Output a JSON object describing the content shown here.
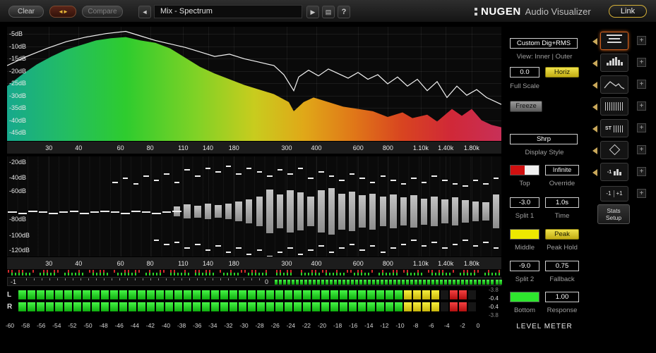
{
  "icons": {
    "swap": "◄►",
    "prev": "◄",
    "play": "▶",
    "list": "▤",
    "add": "+"
  },
  "toolbar": {
    "clear": "Clear",
    "compare": "Compare",
    "preset": "Mix - Spectrum",
    "help": "?",
    "brand_main": "NUGEN",
    "brand_sub": "Audio Visualizer",
    "link": "Link"
  },
  "spectrum": {
    "db_labels": [
      "-5dB",
      "-10dB",
      "-15dB",
      "-20dB",
      "-25dB",
      "-30dB",
      "-35dB",
      "-40dB",
      "-45dB"
    ],
    "freqs": [
      {
        "v": 30,
        "l": "30"
      },
      {
        "v": 40,
        "l": "40"
      },
      {
        "v": 60,
        "l": "60"
      },
      {
        "v": 80,
        "l": "80"
      },
      {
        "v": 110,
        "l": "110"
      },
      {
        "v": 140,
        "l": "140"
      },
      {
        "v": 180,
        "l": "180"
      },
      {
        "v": 300,
        "l": "300"
      },
      {
        "v": 400,
        "l": "400"
      },
      {
        "v": 600,
        "l": "600"
      },
      {
        "v": 800,
        "l": "800"
      },
      {
        "v": 1100,
        "l": "1.10k"
      },
      {
        "v": 1400,
        "l": "1.40k"
      },
      {
        "v": 1800,
        "l": "1.80k"
      }
    ],
    "freq_range": [
      20,
      2400
    ],
    "gradient_stops": [
      [
        "0%",
        "#17a98d"
      ],
      [
        "12%",
        "#23bd62"
      ],
      [
        "24%",
        "#2ecc2e"
      ],
      [
        "38%",
        "#7ed226"
      ],
      [
        "50%",
        "#c8cc1e"
      ],
      [
        "60%",
        "#e0a818"
      ],
      [
        "70%",
        "#e07818"
      ],
      [
        "80%",
        "#d84420"
      ],
      [
        "90%",
        "#d02838"
      ],
      [
        "100%",
        "#c83058"
      ]
    ],
    "fill_curve": [
      [
        0,
        0.52
      ],
      [
        0.03,
        0.42
      ],
      [
        0.06,
        0.33
      ],
      [
        0.09,
        0.26
      ],
      [
        0.12,
        0.2
      ],
      [
        0.15,
        0.16
      ],
      [
        0.18,
        0.12
      ],
      [
        0.21,
        0.1
      ],
      [
        0.24,
        0.09
      ],
      [
        0.27,
        0.12
      ],
      [
        0.3,
        0.14
      ],
      [
        0.33,
        0.19
      ],
      [
        0.36,
        0.27
      ],
      [
        0.39,
        0.35
      ],
      [
        0.42,
        0.41
      ],
      [
        0.45,
        0.46
      ],
      [
        0.48,
        0.51
      ],
      [
        0.51,
        0.55
      ],
      [
        0.54,
        0.59
      ],
      [
        0.57,
        0.66
      ],
      [
        0.58,
        0.74
      ],
      [
        0.6,
        0.66
      ],
      [
        0.62,
        0.62
      ],
      [
        0.65,
        0.66
      ],
      [
        0.68,
        0.7
      ],
      [
        0.71,
        0.72
      ],
      [
        0.74,
        0.74
      ],
      [
        0.77,
        0.79
      ],
      [
        0.8,
        0.75
      ],
      [
        0.82,
        0.8
      ],
      [
        0.85,
        0.77
      ],
      [
        0.87,
        0.83
      ],
      [
        0.9,
        0.72
      ],
      [
        0.92,
        0.78
      ],
      [
        0.94,
        0.72
      ],
      [
        0.96,
        0.82
      ],
      [
        0.98,
        0.86
      ],
      [
        1,
        0.88
      ]
    ],
    "line_curve": [
      [
        0,
        0.34
      ],
      [
        0.04,
        0.26
      ],
      [
        0.08,
        0.19
      ],
      [
        0.12,
        0.13
      ],
      [
        0.16,
        0.09
      ],
      [
        0.2,
        0.06
      ],
      [
        0.24,
        0.04
      ],
      [
        0.27,
        0.08
      ],
      [
        0.3,
        0.12
      ],
      [
        0.33,
        0.15
      ],
      [
        0.36,
        0.18
      ],
      [
        0.39,
        0.22
      ],
      [
        0.42,
        0.26
      ],
      [
        0.45,
        0.24
      ],
      [
        0.48,
        0.28
      ],
      [
        0.51,
        0.31
      ],
      [
        0.54,
        0.34
      ],
      [
        0.56,
        0.42
      ],
      [
        0.58,
        0.56
      ],
      [
        0.59,
        0.44
      ],
      [
        0.61,
        0.38
      ],
      [
        0.63,
        0.43
      ],
      [
        0.65,
        0.37
      ],
      [
        0.67,
        0.41
      ],
      [
        0.69,
        0.45
      ],
      [
        0.71,
        0.4
      ],
      [
        0.73,
        0.46
      ],
      [
        0.75,
        0.42
      ],
      [
        0.77,
        0.5
      ],
      [
        0.79,
        0.44
      ],
      [
        0.81,
        0.52
      ],
      [
        0.83,
        0.46
      ],
      [
        0.85,
        0.56
      ],
      [
        0.87,
        0.48
      ],
      [
        0.89,
        0.62
      ],
      [
        0.91,
        0.52
      ],
      [
        0.93,
        0.6
      ],
      [
        0.95,
        0.55
      ],
      [
        0.97,
        0.62
      ],
      [
        1,
        0.68
      ]
    ]
  },
  "histogram": {
    "db_labels": [
      {
        "l": "-20dB",
        "p": 0.03
      },
      {
        "l": "-40dB",
        "p": 0.18
      },
      {
        "l": "-60dB",
        "p": 0.32
      },
      {
        "l": "-80dB",
        "p": 0.6
      },
      {
        "l": "-100dB",
        "p": 0.76
      },
      {
        "l": "-120dB",
        "p": 0.91
      }
    ],
    "center": 0.55,
    "slots": 48,
    "bars": [
      null,
      null,
      null,
      null,
      null,
      null,
      null,
      null,
      null,
      null,
      null,
      null,
      null,
      null,
      null,
      null,
      0.1,
      0.14,
      0.12,
      0.16,
      0.13,
      0.15,
      0.2,
      0.24,
      0.3,
      0.44,
      0.34,
      0.42,
      0.38,
      0.3,
      0.42,
      0.46,
      0.36,
      0.4,
      0.32,
      0.36,
      0.3,
      0.34,
      0.28,
      0.32,
      0.26,
      0.3,
      0.24,
      0.28,
      0.22,
      0.2,
      0.18,
      0.34
    ],
    "top_dashes": [
      null,
      null,
      null,
      null,
      null,
      null,
      null,
      null,
      null,
      null,
      0.3,
      0.34,
      0.28,
      0.36,
      0.32,
      0.38,
      0.3,
      0.42,
      0.36,
      0.44,
      0.4,
      0.46,
      0.38,
      0.44,
      0.4,
      0.36,
      0.42,
      0.38,
      0.44,
      0.34,
      0.4,
      0.36,
      0.32,
      0.38,
      0.34,
      0.3,
      0.36,
      0.32,
      0.28,
      0.34,
      0.3,
      0.36,
      0.32,
      0.28,
      0.26,
      0.32,
      0.28,
      0.34
    ],
    "bottom_dashes": [
      null,
      null,
      null,
      null,
      null,
      null,
      null,
      null,
      null,
      null,
      null,
      null,
      null,
      null,
      0.28,
      0.32,
      0.3,
      0.36,
      0.32,
      0.38,
      0.34,
      0.4,
      0.36,
      0.42,
      0.38,
      0.44,
      0.4,
      0.36,
      0.42,
      0.38,
      0.34,
      0.4,
      0.36,
      0.32,
      0.38,
      0.34,
      0.4,
      0.36,
      0.32,
      0.28,
      0.34,
      0.3,
      0.36,
      0.32,
      0.28,
      0.34,
      0.3,
      0.36
    ],
    "center_dashes": [
      0,
      0.01,
      -0.01,
      0,
      0.01,
      0,
      -0.01,
      0.01,
      0,
      -0.01,
      0,
      0.01,
      -0.01,
      0,
      0.01,
      0,
      -0.01
    ]
  },
  "correlation": {
    "min_label": "-1",
    "zero_label": "0"
  },
  "meter": {
    "channels": [
      "L",
      "R"
    ],
    "blocks": 50,
    "green_until": 41,
    "yellow_until": 45,
    "red_blocks": [
      47,
      48
    ],
    "readouts": [
      "-3.8",
      "-0.4",
      "-0.4",
      "-3.8"
    ],
    "scale": [
      "-60",
      "-58",
      "-56",
      "-54",
      "-52",
      "-50",
      "-48",
      "-46",
      "-44",
      "-42",
      "-40",
      "-38",
      "-36",
      "-34",
      "-32",
      "-30",
      "-28",
      "-26",
      "-24",
      "-22",
      "-20",
      "-18",
      "-16",
      "-14",
      "-12",
      "-10",
      "-8",
      "-6",
      "-4",
      "-2",
      "0"
    ]
  },
  "controls": {
    "mode_value": "Custom Dig+RMS",
    "view_label": "View: Inner | Outer",
    "full_scale_value": "0.0",
    "horiz_label": "Horiz",
    "full_scale_label": "Full Scale",
    "freeze_label": "Freeze",
    "display_style_value": "Shrp",
    "display_style_label": "Display Style",
    "infinite_label": "Infinite",
    "top_label": "Top",
    "override_label": "Override",
    "split1_value": "-3.0",
    "time_value": "1.0s",
    "split1_label": "Split 1",
    "time_label": "Time",
    "peak_label": "Peak",
    "middle_label": "Middle",
    "peak_hold_label": "Peak Hold",
    "split2_value": "-9.0",
    "fallback_value": "0.75",
    "split2_label": "Split 2",
    "fallback_label": "Fallback",
    "response_value": "1.00",
    "bottom_label": "Bottom",
    "response_label": "Response",
    "meter_title": "LEVEL METER",
    "top_swatch_colors": [
      "#d01010",
      "#f0f0f0"
    ],
    "middle_swatch_color": "#ede800",
    "bottom_swatch_color": "#2ee62e"
  },
  "sidebar": {
    "add_label": "+",
    "rows": [
      {
        "name": "layout-lines",
        "selected": true
      },
      {
        "name": "histogram",
        "selected": false
      },
      {
        "name": "spectrum-curve",
        "selected": false
      },
      {
        "name": "spectrogram",
        "selected": false
      },
      {
        "name": "stereo-meter",
        "selected": false,
        "text": "ST"
      },
      {
        "name": "vectorscope",
        "selected": false
      },
      {
        "name": "correlation-meter",
        "selected": false,
        "text": "-1"
      }
    ],
    "range_button": {
      "left": "-1",
      "right": "+1"
    },
    "stats_button": {
      "line1": "Stats",
      "line2": "Setup"
    }
  }
}
